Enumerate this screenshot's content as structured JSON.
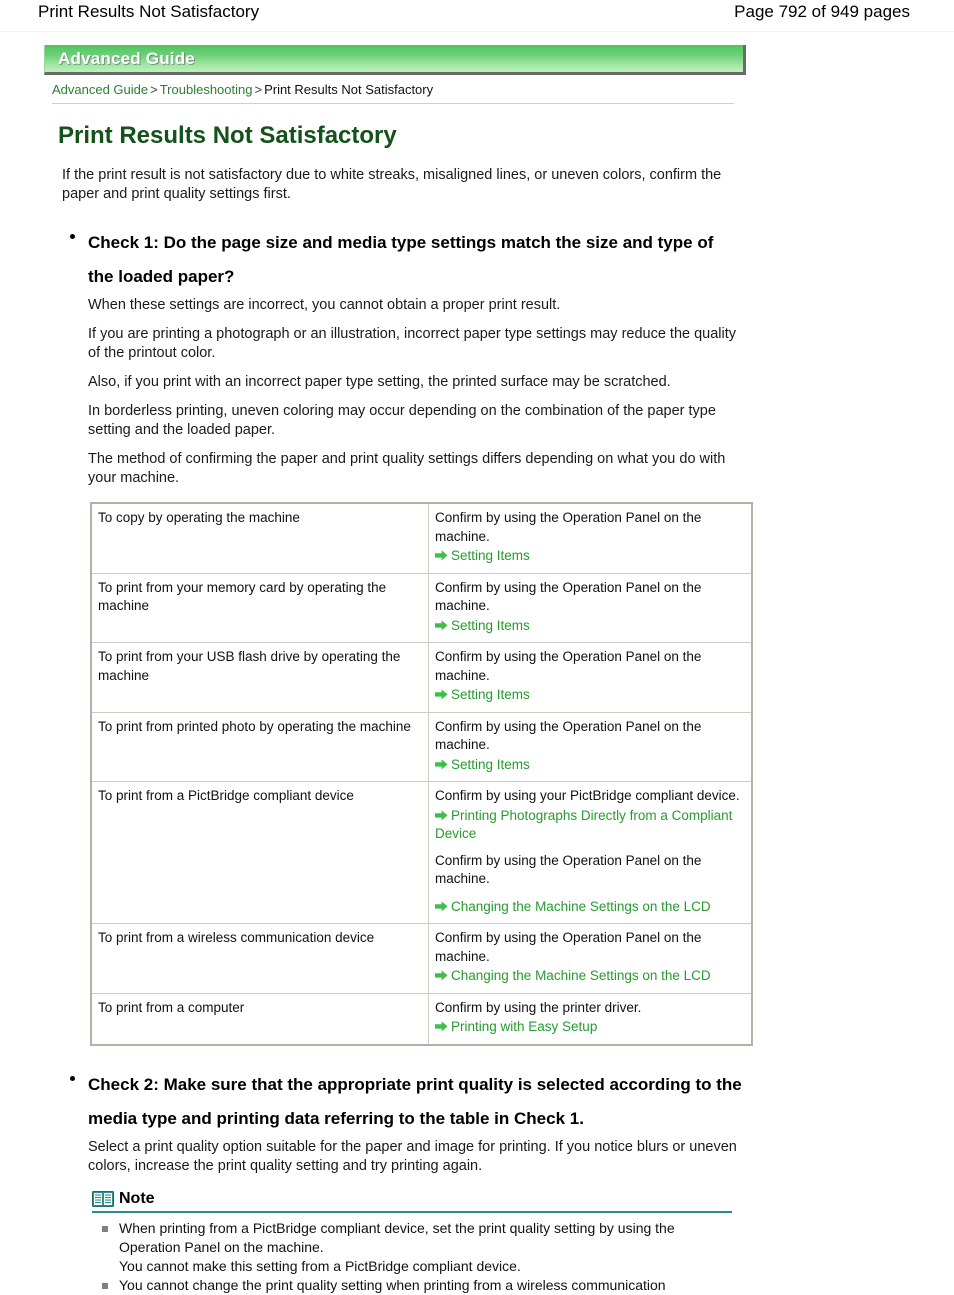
{
  "page_header": {
    "title": "Print Results Not Satisfactory",
    "page_number": "Page 792 of 949 pages"
  },
  "banner": {
    "label": "Advanced Guide"
  },
  "breadcrumb": {
    "item1": "Advanced Guide",
    "sep1": ">",
    "item2": "Troubleshooting",
    "sep2": ">",
    "current": "Print Results Not Satisfactory"
  },
  "doc": {
    "title": "Print Results Not Satisfactory",
    "intro": "If the print result is not satisfactory due to white streaks, misaligned lines, or uneven colors, confirm the paper and print quality settings first."
  },
  "check1": {
    "heading": "Check 1: Do the page size and media type settings match the size and type of the loaded paper?",
    "paragraphs": [
      "When these settings are incorrect, you cannot obtain a proper print result.",
      "If you are printing a photograph or an illustration, incorrect paper type settings may reduce the quality of the printout color.",
      "Also, if you print with an incorrect paper type setting, the printed surface may be scratched.",
      "In borderless printing, uneven coloring may occur depending on the combination of the paper type setting and the loaded paper.",
      "The method of confirming the paper and print quality settings differs depending on what you do with your machine."
    ]
  },
  "settings_table": {
    "rows": [
      {
        "task": "To copy by operating the machine",
        "action_lines": [
          "Confirm by using the Operation Panel on the machine."
        ],
        "links": [
          "Setting Items"
        ]
      },
      {
        "task": "To print from your memory card by operating the machine",
        "action_lines": [
          "Confirm by using the Operation Panel on the machine."
        ],
        "links": [
          "Setting Items"
        ]
      },
      {
        "task": "To print from your USB flash drive by operating the machine",
        "action_lines": [
          "Confirm by using the Operation Panel on the machine."
        ],
        "links": [
          "Setting Items"
        ]
      },
      {
        "task": "To print from printed photo by operating the machine",
        "action_lines": [
          "Confirm by using the Operation Panel on the machine."
        ],
        "links": [
          "Setting Items"
        ]
      },
      {
        "task": "To print from a PictBridge compliant device",
        "action_lines": [
          "Confirm by using your PictBridge compliant device."
        ],
        "links": [
          "Printing Photographs Directly from a Compliant Device"
        ],
        "action_lines2": [
          "Confirm by using the Operation Panel on the machine."
        ],
        "links2": [
          "Changing the Machine Settings on the LCD"
        ]
      },
      {
        "task": "To print from a wireless communication device",
        "action_lines": [
          "Confirm by using the Operation Panel on the machine."
        ],
        "links": [
          "Changing the Machine Settings on the LCD"
        ]
      },
      {
        "task": "To print from a computer",
        "action_lines": [
          "Confirm by using the printer driver."
        ],
        "links": [
          "Printing with Easy Setup"
        ]
      }
    ]
  },
  "check2": {
    "heading": "Check 2: Make sure that the appropriate print quality is selected according to the media type and printing data referring to the table in Check 1.",
    "paragraph": "Select a print quality option suitable for the paper and image for printing. If you notice blurs or uneven colors, increase the print quality setting and try printing again."
  },
  "note": {
    "title": "Note",
    "items": [
      "When printing from a PictBridge compliant device, set the print quality setting by using the Operation Panel on the machine.\nYou cannot make this setting from a PictBridge compliant device.",
      "You cannot change the print quality setting when printing from a wireless communication"
    ]
  },
  "colors": {
    "banner_green_top": "#4fc45f",
    "banner_green_bottom": "#bdf0bd",
    "title_green": "#13521a",
    "link_green": "#279b2e",
    "note_teal": "#2e8b8b",
    "table_border": "#b3b1a5"
  }
}
